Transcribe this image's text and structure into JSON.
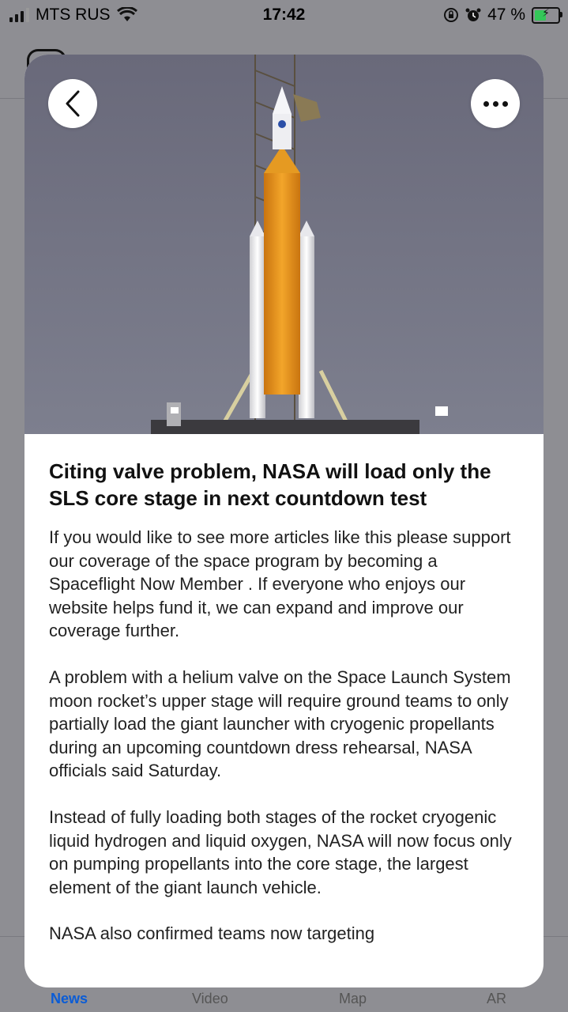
{
  "status_bar": {
    "carrier": "MTS RUS",
    "time": "17:42",
    "battery_percent": "47 %",
    "battery_level": 0.47
  },
  "tab_bar": {
    "tabs": [
      {
        "label": "News",
        "active": true
      },
      {
        "label": "Video",
        "active": false
      },
      {
        "label": "Map",
        "active": false
      },
      {
        "label": "AR",
        "active": false
      }
    ]
  },
  "article": {
    "title": "Citing valve problem, NASA will load only the SLS core stage in next countdown test",
    "paragraphs": [
      "If you would like to see more articles like this please support our coverage of the space program by becoming a Spaceflight Now Member . If everyone who enjoys our website helps fund it, we can expand and improve our coverage further.",
      "A problem with a helium valve on the Space Launch System moon rocket’s upper stage will require ground teams to only partially load the giant launcher with cryogenic propellants during an upcoming countdown dress rehearsal, NASA officials said Saturday.",
      "Instead of fully loading both stages of the rocket cryogenic liquid hydrogen and liquid oxygen, NASA will now focus only on pumping propellants into the core stage, the largest element of the giant launch vehicle.",
      "NASA also confirmed teams now targeting"
    ]
  },
  "icons": {
    "back": "chevron-left-icon",
    "more": "ellipsis-icon",
    "wifi": "wifi-icon",
    "alarm": "alarm-icon",
    "lock_rotation": "rotation-lock-icon"
  },
  "colors": {
    "accent": "#0a5cd6",
    "rocket_core": "#e89a1a",
    "sky": "#6d6e80"
  }
}
